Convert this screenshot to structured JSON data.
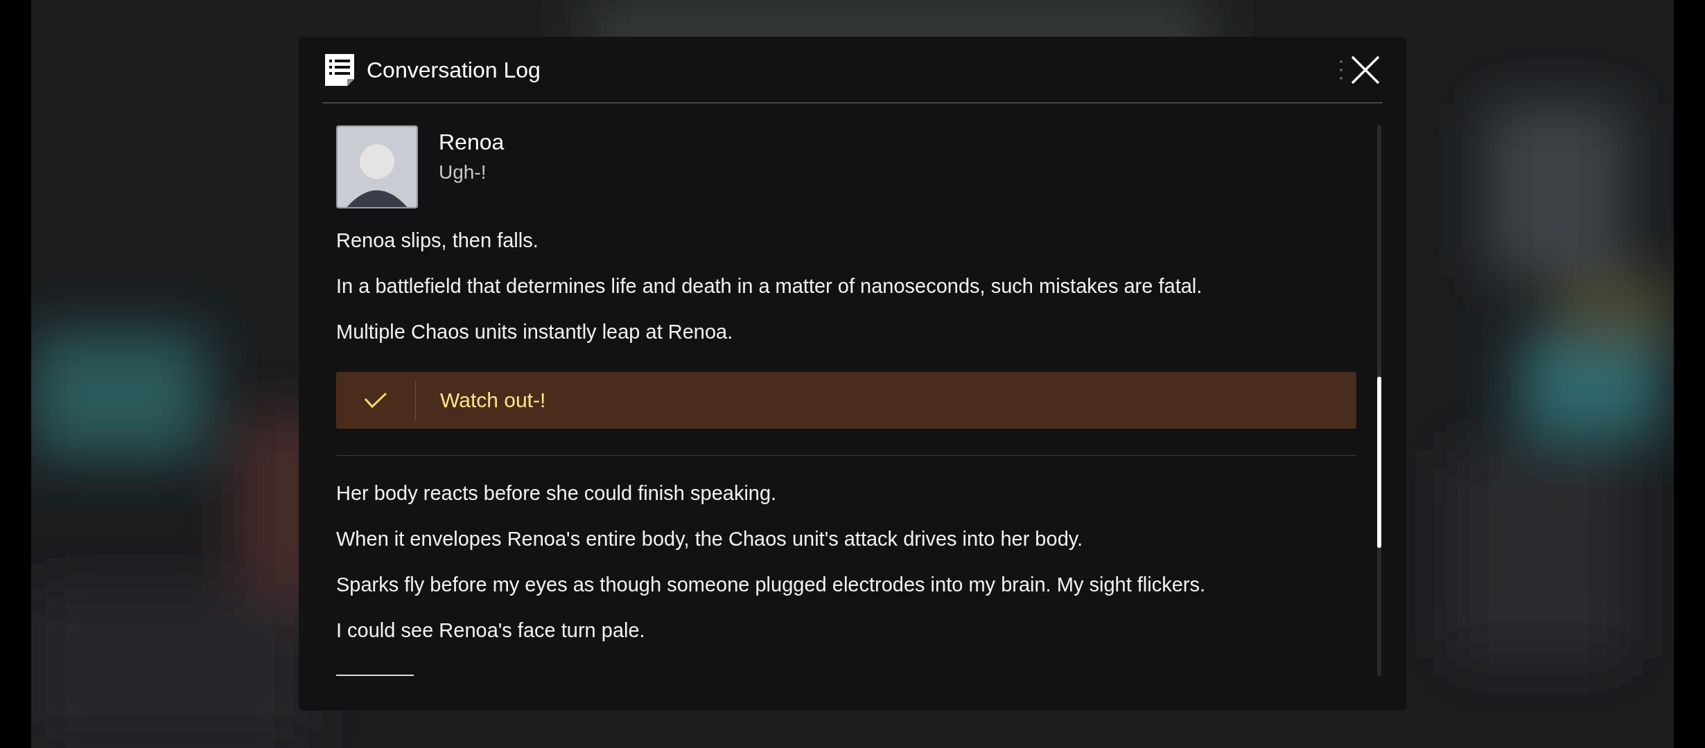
{
  "window": {
    "title": "Conversation Log"
  },
  "log": [
    {
      "kind": "speaker",
      "name": "Renoa",
      "line": "Ugh-!"
    },
    {
      "kind": "narration",
      "text": "Renoa slips, then falls."
    },
    {
      "kind": "narration",
      "text": "In a battlefield that determines life and death in a matter of nanoseconds, such mistakes are fatal."
    },
    {
      "kind": "narration",
      "text": "Multiple Chaos units instantly leap at Renoa."
    },
    {
      "kind": "choice",
      "text": "Watch out-!",
      "selected": true
    },
    {
      "kind": "narration",
      "text": "Her body reacts before she could finish speaking."
    },
    {
      "kind": "narration",
      "text": "When it envelopes Renoa's entire body, the Chaos unit's attack drives into her body."
    },
    {
      "kind": "narration",
      "text": "Sparks fly before my eyes as though someone plugged electrodes into my brain. My sight flickers."
    },
    {
      "kind": "narration",
      "text": "I could see Renoa's face turn pale."
    }
  ]
}
